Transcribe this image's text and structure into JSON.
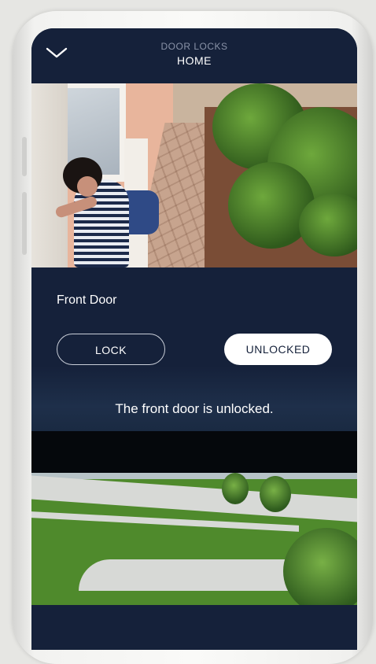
{
  "header": {
    "subtitle": "DOOR LOCKS",
    "title": "HOME"
  },
  "lock_panel": {
    "door_name": "Front Door",
    "lock_button_label": "LOCK",
    "unlocked_button_label": "UNLOCKED",
    "selected_state": "UNLOCKED",
    "status_text": "The front door is unlocked."
  },
  "icons": {
    "back": "chevron-down-icon"
  },
  "colors": {
    "background": "#15213a",
    "button_selected_bg": "#ffffff",
    "button_outline": "#c9ced8"
  }
}
